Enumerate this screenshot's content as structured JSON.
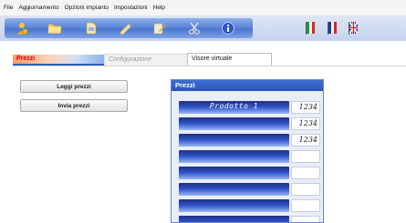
{
  "menu": [
    "File",
    "Aggiornamento",
    "Opzioni impianto",
    "Impostazioni",
    "Help"
  ],
  "toolbar": {
    "buttons": [
      "user-lock-icon",
      "folder-icon",
      "device-icon",
      "pen-icon",
      "edit-icon",
      "scissors-icon",
      "info-icon"
    ],
    "languages": [
      "italian-flag-icon",
      "french-flag-icon",
      "uk-flag-icon"
    ]
  },
  "tabs": {
    "prezzi": "Prezzi",
    "configurazione": "Configurazione",
    "visore": "Visore virtuale"
  },
  "buttons": {
    "leggi": "Leggi prezzi",
    "invia": "Invia prezzi"
  },
  "panel": {
    "title": "Prezzi",
    "rows": [
      {
        "name": "Prodotto 1",
        "value": "1234"
      },
      {
        "name": "",
        "value": "1234"
      },
      {
        "name": "",
        "value": "1234"
      },
      {
        "name": "",
        "value": ""
      },
      {
        "name": "",
        "value": ""
      },
      {
        "name": "",
        "value": ""
      },
      {
        "name": "",
        "value": ""
      },
      {
        "name": "",
        "value": ""
      },
      {
        "name": "",
        "value": ""
      }
    ]
  },
  "colors": {
    "tab_accent": "#d40000",
    "panel_header": "#2f5fc4",
    "toolbar": "#5c86d9"
  }
}
